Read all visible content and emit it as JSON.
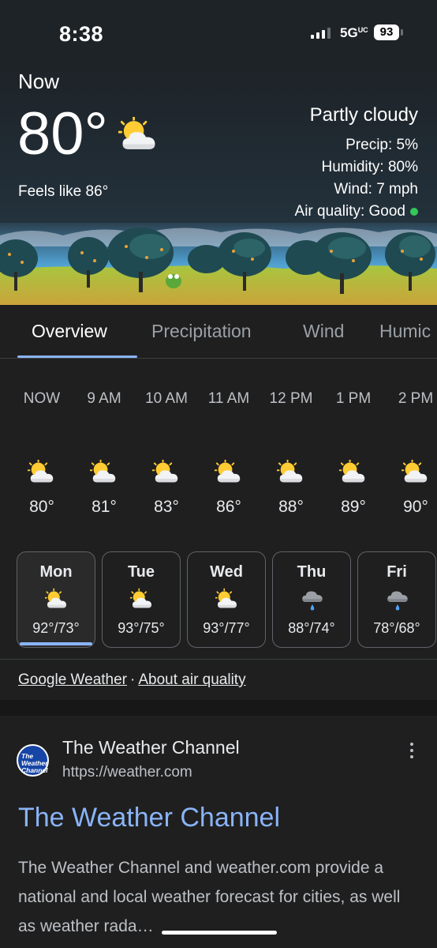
{
  "status": {
    "time": "8:38",
    "network": "5G",
    "network_sub": "UC",
    "battery": "93"
  },
  "now": {
    "label": "Now",
    "temperature": "80°",
    "icon": "partly-cloudy-icon",
    "feels_like": "Feels like 86°",
    "condition": "Partly cloudy",
    "precip": "Precip: 5%",
    "humidity": "Humidity: 80%",
    "wind": "Wind: 7 mph",
    "air_quality": "Air quality: Good"
  },
  "tabs": [
    {
      "label": "Overview"
    },
    {
      "label": "Precipitation"
    },
    {
      "label": "Wind"
    },
    {
      "label": "Humic"
    }
  ],
  "hourly": [
    {
      "time": "NOW",
      "temp": "80°",
      "icon": "partly-cloudy-icon"
    },
    {
      "time": "9 AM",
      "temp": "81°",
      "icon": "partly-cloudy-icon"
    },
    {
      "time": "10 AM",
      "temp": "83°",
      "icon": "partly-cloudy-icon"
    },
    {
      "time": "11 AM",
      "temp": "86°",
      "icon": "partly-cloudy-icon"
    },
    {
      "time": "12 PM",
      "temp": "88°",
      "icon": "partly-cloudy-icon"
    },
    {
      "time": "1 PM",
      "temp": "89°",
      "icon": "partly-cloudy-icon"
    },
    {
      "time": "2 PM",
      "temp": "90°",
      "icon": "partly-cloudy-icon"
    }
  ],
  "daily": [
    {
      "day": "Mon",
      "range": "92°/73°",
      "icon": "partly-cloudy-icon"
    },
    {
      "day": "Tue",
      "range": "93°/75°",
      "icon": "partly-cloudy-icon"
    },
    {
      "day": "Wed",
      "range": "93°/77°",
      "icon": "partly-cloudy-icon"
    },
    {
      "day": "Thu",
      "range": "88°/74°",
      "icon": "rain-icon"
    },
    {
      "day": "Fri",
      "range": "78°/68°",
      "icon": "rain-icon"
    }
  ],
  "links": {
    "google_weather": "Google Weather",
    "separator": "·",
    "about_air_quality": "About air quality"
  },
  "result": {
    "favicon_text": "The Weather Channel",
    "site_name": "The Weather Channel",
    "url": "https://weather.com",
    "title": "The Weather Channel",
    "snippet": "The Weather Channel and weather.com provide a national and local weather forecast for cities, as well as weather rada…"
  },
  "colors": {
    "accent": "#8ab4f8",
    "background": "#1f1f1f",
    "aq_good": "#34c759",
    "sun": "#ffcc33"
  }
}
